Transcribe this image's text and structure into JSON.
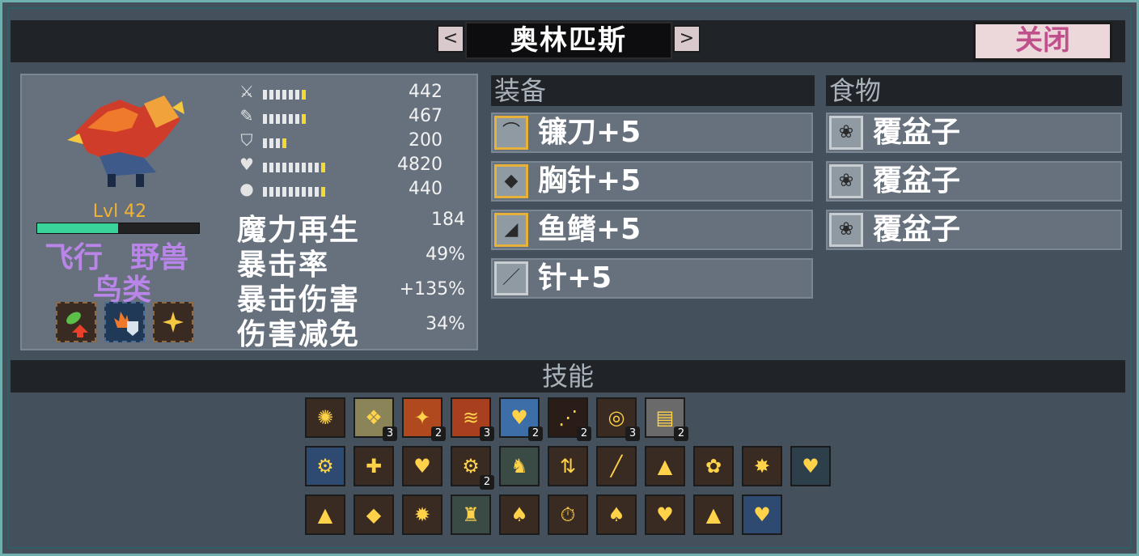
{
  "window": {
    "title": "奥林匹斯",
    "prev_label": "<",
    "next_label": ">",
    "close_label": "关闭"
  },
  "creature": {
    "level": "Lvl 42",
    "hp_fraction": 0.5,
    "traits": [
      "飞行",
      "野兽",
      "鸟类"
    ],
    "abilities": [
      "leaf-up-icon",
      "fire-shield-icon",
      "sparkle-icon"
    ]
  },
  "stats": [
    {
      "icon": "sword-icon",
      "value": "442",
      "segments": 7,
      "yellow": 1
    },
    {
      "icon": "wand-icon",
      "value": "467",
      "segments": 7,
      "yellow": 1
    },
    {
      "icon": "shield-icon",
      "value": "200",
      "segments": 4,
      "yellow": 1
    },
    {
      "icon": "heart-icon",
      "value": "4820",
      "segments": 10,
      "yellow": 1
    },
    {
      "icon": "potion-icon",
      "value": "440",
      "segments": 10,
      "yellow": 1
    }
  ],
  "big_stats": [
    {
      "label": "魔力再生",
      "value": "184"
    },
    {
      "label": "暴击率",
      "value": "49%"
    },
    {
      "label": "暴击伤害",
      "value": "+135%"
    },
    {
      "label": "伤害减免",
      "value": "34%"
    }
  ],
  "equipment": {
    "title": "装备",
    "items": [
      {
        "label": "镰刀+5",
        "icon": "scythe-icon",
        "gold": true
      },
      {
        "label": "胸针+5",
        "icon": "brooch-icon",
        "gold": true
      },
      {
        "label": "鱼鳍+5",
        "icon": "fin-icon",
        "gold": true
      },
      {
        "label": "针+5",
        "icon": "needle-icon",
        "gold": false
      }
    ]
  },
  "food": {
    "title": "食物",
    "items": [
      {
        "label": "覆盆子",
        "icon": "raspberry-icon"
      },
      {
        "label": "覆盆子",
        "icon": "raspberry-icon"
      },
      {
        "label": "覆盆子",
        "icon": "raspberry-icon"
      }
    ]
  },
  "skills": {
    "title": "技能",
    "rows": [
      [
        {
          "icon": "burst-icon",
          "bg": "#3a2b22",
          "badge": ""
        },
        {
          "icon": "feathers-icon",
          "bg": "#8a8458",
          "badge": "3"
        },
        {
          "icon": "fire-slash-icon",
          "bg": "#b04a1e",
          "badge": "2"
        },
        {
          "icon": "triple-slash-icon",
          "bg": "#a84020",
          "badge": "3"
        },
        {
          "icon": "heart-shield-icon",
          "bg": "#3d6ea8",
          "badge": "2"
        },
        {
          "icon": "meteor-icon",
          "bg": "#2a1d18",
          "badge": "2"
        },
        {
          "icon": "target-burst-icon",
          "bg": "#3a2b22",
          "badge": "3"
        },
        {
          "icon": "stripes-icon",
          "bg": "#6a6a6a",
          "badge": "2"
        }
      ],
      [
        {
          "icon": "cog-shield-icon",
          "bg": "#2e4a70",
          "badge": ""
        },
        {
          "icon": "mana-up-icon",
          "bg": "#3a2b22",
          "badge": ""
        },
        {
          "icon": "purple-heart-icon",
          "bg": "#3a2b22",
          "badge": ""
        },
        {
          "icon": "gear-icon",
          "bg": "#3a2b22",
          "badge": "2"
        },
        {
          "icon": "knight-icon",
          "bg": "#3a4a44",
          "badge": ""
        },
        {
          "icon": "swap-arrows-icon",
          "bg": "#3a2b22",
          "badge": ""
        },
        {
          "icon": "red-blade-icon",
          "bg": "#3a2b22",
          "badge": ""
        },
        {
          "icon": "fire-up-icon",
          "bg": "#3a2b22",
          "badge": ""
        },
        {
          "icon": "paw-icon",
          "bg": "#3a2b22",
          "badge": ""
        },
        {
          "icon": "fire-sparkle-icon",
          "bg": "#3a2b22",
          "badge": ""
        },
        {
          "icon": "teal-heart-icon",
          "bg": "#2c3f4a",
          "badge": ""
        }
      ],
      [
        {
          "icon": "flame-icon",
          "bg": "#3a2b22",
          "badge": ""
        },
        {
          "icon": "purple-flame-icon",
          "bg": "#3a2b22",
          "badge": ""
        },
        {
          "icon": "phoenix-icon",
          "bg": "#3a2b22",
          "badge": ""
        },
        {
          "icon": "statue-icon",
          "bg": "#3a4a44",
          "badge": ""
        },
        {
          "icon": "orange-bat-icon",
          "bg": "#3a2b22",
          "badge": ""
        },
        {
          "icon": "timer-potion-icon",
          "bg": "#3a2b22",
          "badge": ""
        },
        {
          "icon": "grey-bat-icon",
          "bg": "#3a2b22",
          "badge": ""
        },
        {
          "icon": "fire-heart-icon",
          "bg": "#3a2b22",
          "badge": ""
        },
        {
          "icon": "mushroom-potion-icon",
          "bg": "#3a2b22",
          "badge": ""
        },
        {
          "icon": "blue-hearts-icon",
          "bg": "#2e4a70",
          "badge": ""
        }
      ]
    ]
  },
  "colors": {
    "accent_gold": "#e6b23a",
    "trait_purple": "#b985e8",
    "level_orange": "#f3b234",
    "hp_green": "#3ad49a",
    "close_text": "#c0508c"
  }
}
